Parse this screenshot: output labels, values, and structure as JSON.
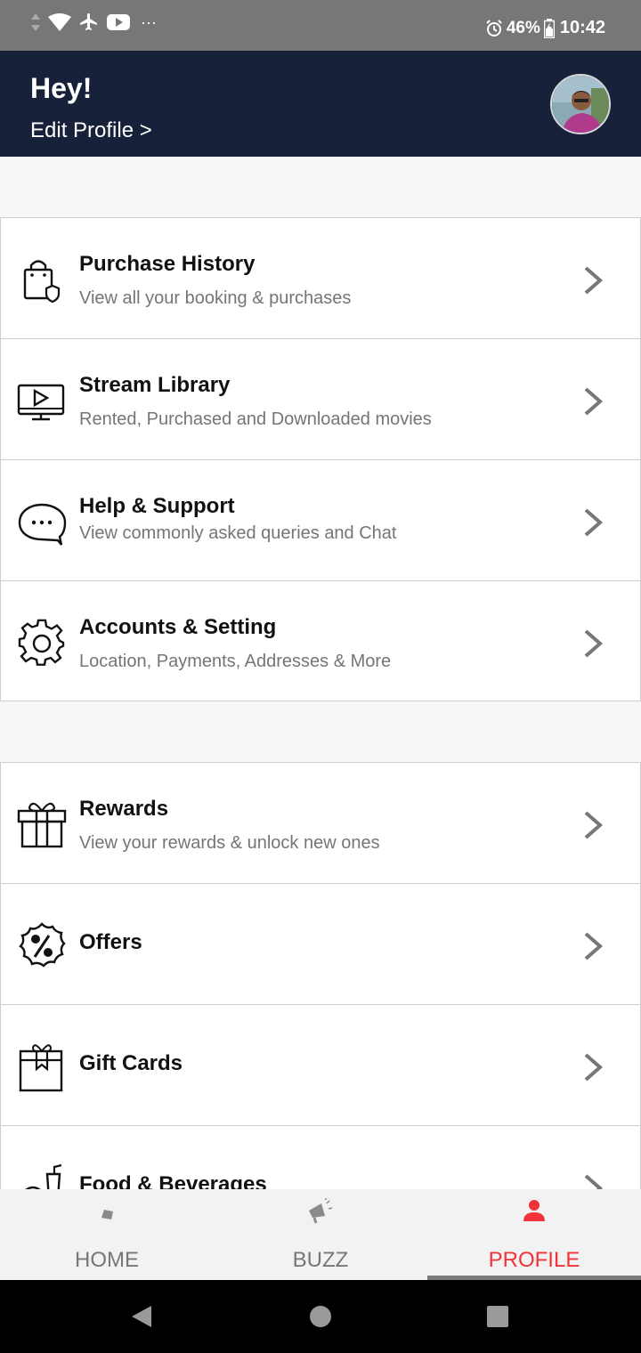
{
  "status_bar": {
    "battery": "46%",
    "time": "10:42",
    "more": "···",
    "icons": [
      "data-arrows-icon",
      "wifi-icon",
      "airplane-icon",
      "youtube-icon",
      "alarm-icon",
      "battery-icon"
    ]
  },
  "header": {
    "greeting": "Hey!",
    "edit_profile": "Edit Profile >"
  },
  "menu": {
    "group1": [
      {
        "title": "Purchase History",
        "subtitle": "View all your booking & purchases",
        "icon": "shopping-bag-icon"
      },
      {
        "title": "Stream Library",
        "subtitle": "Rented, Purchased and Downloaded movies",
        "icon": "tv-play-icon"
      },
      {
        "title": "Help & Support",
        "subtitle": "View commonly asked queries and Chat",
        "icon": "chat-bubble-icon"
      },
      {
        "title": "Accounts & Setting",
        "subtitle": "Location, Payments, Addresses & More",
        "icon": "gear-icon"
      }
    ],
    "group2": [
      {
        "title": "Rewards",
        "subtitle": "View your rewards & unlock new ones",
        "icon": "gift-icon"
      },
      {
        "title": "Offers",
        "icon": "offer-badge-icon"
      },
      {
        "title": "Gift Cards",
        "icon": "gift-card-icon"
      },
      {
        "title": "Food & Beverages",
        "icon": "food-drink-icon"
      }
    ]
  },
  "bottom_nav": {
    "tabs": [
      {
        "label": "HOME",
        "icon": "home-icon"
      },
      {
        "label": "BUZZ",
        "icon": "megaphone-icon"
      },
      {
        "label": "PROFILE",
        "icon": "person-icon"
      }
    ],
    "active": "PROFILE"
  },
  "colors": {
    "header_bg": "#17213a",
    "accent": "#f0333b",
    "status_bar_bg": "#777777"
  }
}
